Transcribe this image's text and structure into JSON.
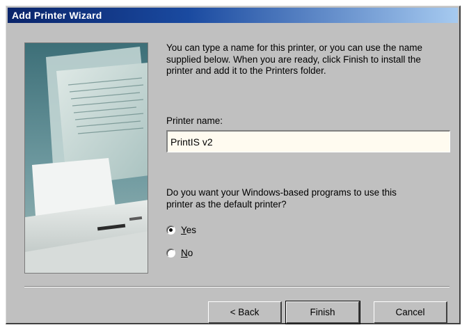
{
  "window": {
    "title": "Add Printer Wizard"
  },
  "intro_text": "You can type a name for this printer, or you can use the name supplied below. When you are ready, click Finish to install the printer and add it to the Printers folder.",
  "printer_name": {
    "label": "Printer name:",
    "value": "PrintIS v2"
  },
  "default_question": "Do you want your Windows-based programs to use this printer as the default printer?",
  "options": {
    "yes": {
      "accel": "Y",
      "rest": "es",
      "selected": true
    },
    "no": {
      "accel": "N",
      "rest": "o",
      "selected": false
    }
  },
  "buttons": {
    "back": "< Back",
    "finish": "Finish",
    "cancel": "Cancel"
  },
  "illustration": {
    "icon": "printer-illustration"
  }
}
